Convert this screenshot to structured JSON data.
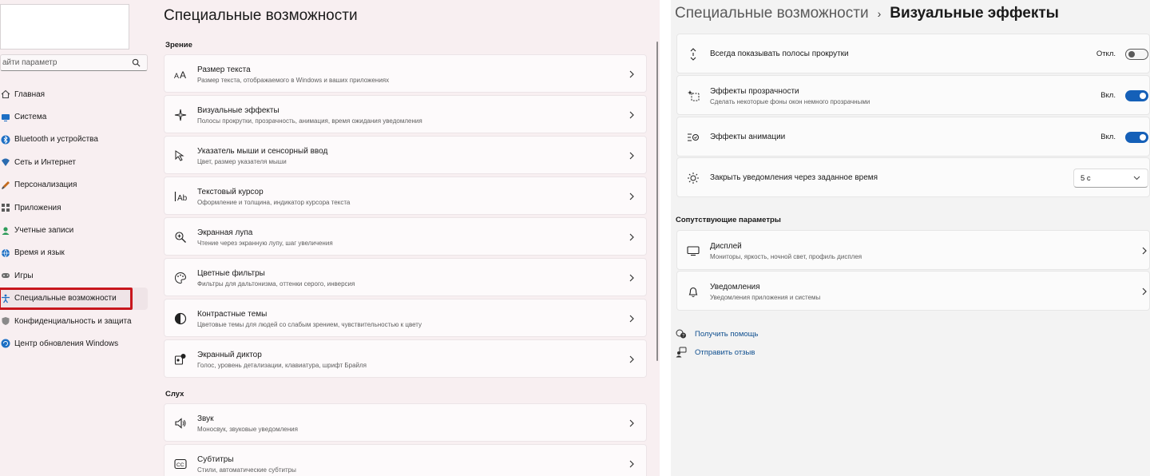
{
  "left": {
    "search": {
      "placeholder": "айти параметр"
    },
    "sidebar": {
      "items": [
        {
          "label": "Главная",
          "icon": "home-icon",
          "color": "#444444"
        },
        {
          "label": "Система",
          "icon": "system-icon",
          "color": "#1d6fc4"
        },
        {
          "label": "Bluetooth и устройства",
          "icon": "bluetooth-icon",
          "color": "#1d6fc4"
        },
        {
          "label": "Сеть и Интернет",
          "icon": "network-icon",
          "color": "#2b6cb0"
        },
        {
          "label": "Персонализация",
          "icon": "brush-icon",
          "color": "#c46b1d"
        },
        {
          "label": "Приложения",
          "icon": "apps-icon",
          "color": "#5a5a5a"
        },
        {
          "label": "Учетные записи",
          "icon": "account-icon",
          "color": "#2e9b5a"
        },
        {
          "label": "Время и язык",
          "icon": "globe-icon",
          "color": "#1d6fc4"
        },
        {
          "label": "Игры",
          "icon": "gamepad-icon",
          "color": "#6b6b6b"
        },
        {
          "label": "Специальные возможности",
          "icon": "accessibility-icon",
          "color": "#1d6fc4",
          "active": true
        },
        {
          "label": "Конфиденциальность и защита",
          "icon": "shield-icon",
          "color": "#6b6b6b"
        },
        {
          "label": "Центр обновления Windows",
          "icon": "update-icon",
          "color": "#1d6fc4"
        }
      ]
    },
    "main": {
      "title": "Специальные возможности",
      "sections": [
        {
          "label": "Зрение",
          "cards": [
            {
              "title": "Размер текста",
              "subtitle": "Размер текста, отображаемого в Windows и ваших приложениях",
              "icon": "text-size-icon"
            },
            {
              "title": "Визуальные эффекты",
              "subtitle": "Полосы прокрутки, прозрачность, анимация, время ожидания уведомления",
              "icon": "sparkle-icon"
            },
            {
              "title": "Указатель мыши и сенсорный ввод",
              "subtitle": "Цвет, размер указателя мыши",
              "icon": "mouse-pointer-icon"
            },
            {
              "title": "Текстовый курсор",
              "subtitle": "Оформление и толщина, индикатор курсора текста",
              "icon": "text-cursor-icon"
            },
            {
              "title": "Экранная лупа",
              "subtitle": "Чтение через экранную лупу, шаг увеличения",
              "icon": "magnifier-icon"
            },
            {
              "title": "Цветные фильтры",
              "subtitle": "Фильтры для дальтонизма, оттенки серого, инверсия",
              "icon": "palette-icon"
            },
            {
              "title": "Контрастные темы",
              "subtitle": "Цветовые темы для людей со слабым зрением, чувствительностью к цвету",
              "icon": "contrast-icon"
            },
            {
              "title": "Экранный диктор",
              "subtitle": "Голос, уровень детализации, клавиатура, шрифт Брайля",
              "icon": "narrator-icon"
            }
          ]
        },
        {
          "label": "Слух",
          "cards": [
            {
              "title": "Звук",
              "subtitle": "Моносвук, звуковые уведомления",
              "icon": "speaker-icon"
            },
            {
              "title": "Субтитры",
              "subtitle": "Стили, автоматические субтитры",
              "icon": "captions-icon"
            }
          ]
        }
      ]
    }
  },
  "right": {
    "breadcrumb": {
      "parent": "Специальные возможности",
      "separator": "›",
      "current": "Визуальные эффекты"
    },
    "settings": [
      {
        "title": "Всегда показывать полосы прокрутки",
        "subtitle": "",
        "icon": "scrollbar-icon",
        "state_label": "Откл.",
        "toggle_on": false
      },
      {
        "title": "Эффекты прозрачности",
        "subtitle": "Сделать некоторые фоны окон немного прозрачными",
        "icon": "transparency-icon",
        "state_label": "Вкл.",
        "toggle_on": true
      },
      {
        "title": "Эффекты анимации",
        "subtitle": "",
        "icon": "animation-icon",
        "state_label": "Вкл.",
        "toggle_on": true
      },
      {
        "title": "Закрыть уведомления через заданное время",
        "subtitle": "",
        "icon": "brightness-icon",
        "dropdown_value": "5 с"
      }
    ],
    "related": {
      "label": "Сопутствующие параметры",
      "items": [
        {
          "title": "Дисплей",
          "subtitle": "Мониторы, яркость, ночной свет, профиль дисплея",
          "icon": "display-icon"
        },
        {
          "title": "Уведомления",
          "subtitle": "Уведомления приложения и системы",
          "icon": "bell-icon"
        }
      ]
    },
    "links": [
      {
        "label": "Получить помощь",
        "icon": "help-icon"
      },
      {
        "label": "Отправить отзыв",
        "icon": "feedback-icon"
      }
    ],
    "colors": {
      "accent": "#1560b8",
      "link": "#0f4f8f",
      "highlight": "#c8161d"
    }
  }
}
